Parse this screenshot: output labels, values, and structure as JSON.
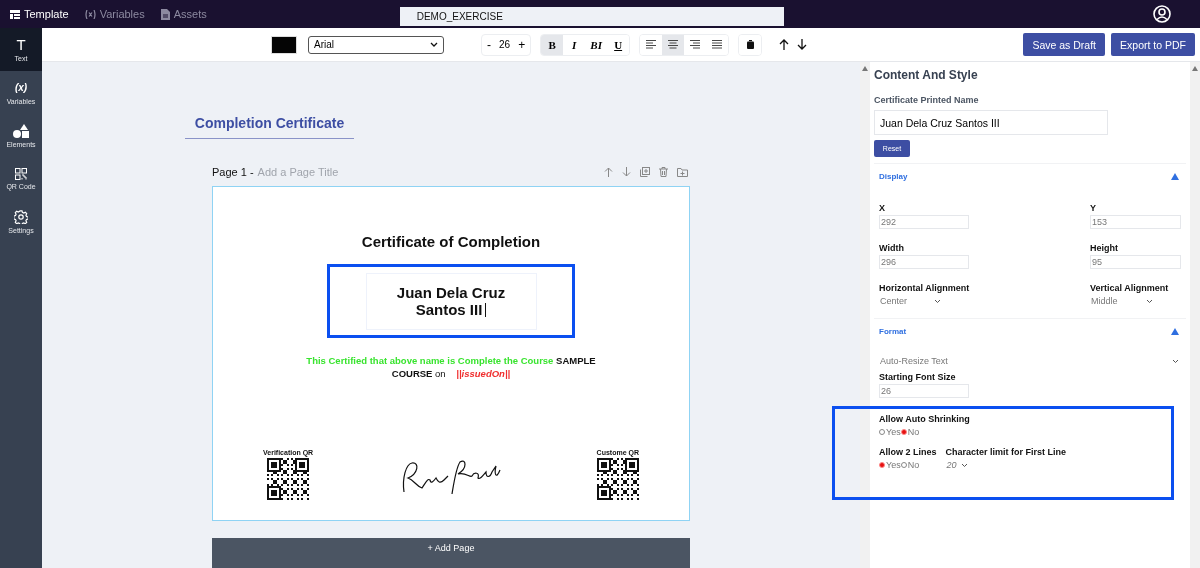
{
  "top_nav": {
    "tabs": [
      {
        "label": "Template",
        "selected": true
      },
      {
        "label": "Variables",
        "selected": false
      },
      {
        "label": "Assets",
        "selected": false
      }
    ],
    "document_name": "DEMO_EXERCISE"
  },
  "sidebar": {
    "items": [
      {
        "label": "Text",
        "glyph": "T",
        "selected": true
      },
      {
        "label": "Variables",
        "glyph": "(x)",
        "selected": false
      },
      {
        "label": "Elements",
        "selected": false
      },
      {
        "label": "QR Code",
        "selected": false
      },
      {
        "label": "Settings",
        "selected": false
      }
    ]
  },
  "toolbar": {
    "font": "Arial",
    "decrease": "-",
    "font_size": "26",
    "increase": "+",
    "styles": [
      {
        "label": "B",
        "kind": "bold",
        "selected": true
      },
      {
        "label": "I",
        "kind": "italic",
        "selected": false
      },
      {
        "label": "BI",
        "kind": "bolditalic",
        "selected": false
      },
      {
        "label": "U",
        "kind": "underline",
        "selected": false
      }
    ],
    "alignments": [
      {
        "kind": "left",
        "selected": false
      },
      {
        "kind": "center",
        "selected": true
      },
      {
        "kind": "right",
        "selected": false
      },
      {
        "kind": "justify",
        "selected": false
      }
    ],
    "buttons": [
      "Save as Draft",
      "Export to PDF"
    ]
  },
  "canvas": {
    "title": "Completion Certificate",
    "page_label": "Page 1 -",
    "page_title_placeholder": "Add a Page Title",
    "certificate": {
      "heading": "Certificate of Completion",
      "name_lines": [
        "Juan Dela Cruz",
        "Santos III"
      ],
      "body": [
        {
          "text": "This Certified that above name is Complete the Course",
          "kind": "static"
        },
        {
          "text": "SAMPLE COURSE",
          "kind": "bold"
        },
        {
          "text": "on",
          "kind": "plain"
        },
        {
          "text": "||issuedOn||",
          "kind": "variable"
        }
      ],
      "qr_codes": [
        {
          "label": "Verification QR"
        },
        {
          "label": "Custome QR"
        }
      ]
    },
    "add_page": "+ Add Page"
  },
  "panel": {
    "title": "Content And Style",
    "name_label": "Certificate Printed Name",
    "name_value": "Juan Dela Cruz Santos III",
    "reset": "Reset",
    "display": {
      "title": "Display",
      "expanded": true,
      "fields": [
        {
          "label": "X",
          "value": "292"
        },
        {
          "label": "Y",
          "value": "153"
        },
        {
          "label": "Width",
          "value": "296"
        },
        {
          "label": "Height",
          "value": "95"
        }
      ],
      "selects": [
        {
          "label": "Horizontal Alignment",
          "value": "Center"
        },
        {
          "label": "Vertical Alignment",
          "value": "Middle"
        }
      ]
    },
    "format": {
      "title": "Format",
      "expanded": true,
      "mode": "Auto-Resize Text",
      "font_size_label": "Starting Font Size",
      "font_size": "26",
      "auto_shrink": {
        "label": "Allow Auto Shrinking",
        "options": [
          {
            "label": "Yes",
            "selected": false
          },
          {
            "label": "No",
            "selected": true
          }
        ]
      },
      "two_lines": {
        "label": "Allow 2 Lines",
        "options": [
          {
            "label": "Yes",
            "selected": true
          },
          {
            "label": "No",
            "selected": false
          }
        ]
      },
      "char_limit": {
        "label": "Character limit for First Line",
        "value": "20"
      }
    }
  }
}
